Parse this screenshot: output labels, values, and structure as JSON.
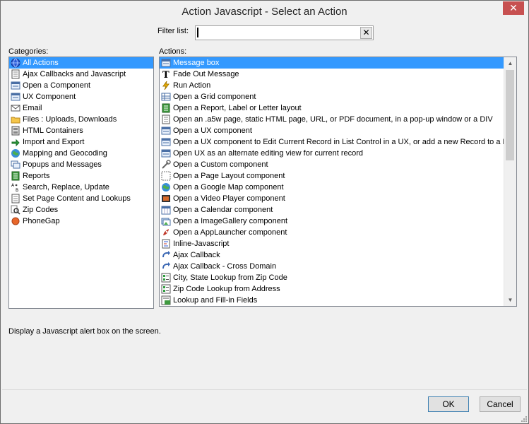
{
  "window": {
    "title": "Action Javascript - Select an Action",
    "close_glyph": "✕"
  },
  "filter": {
    "label": "Filter list:",
    "value": "",
    "clear_glyph": "✕"
  },
  "categories": {
    "label": "Categories:",
    "items": [
      {
        "label": "All Actions",
        "icon": "globe-icon",
        "selected": true
      },
      {
        "label": "Ajax Callbacks and Javascript",
        "icon": "document-icon"
      },
      {
        "label": "Open a Component",
        "icon": "window-icon"
      },
      {
        "label": "UX Component",
        "icon": "form-icon"
      },
      {
        "label": "Email",
        "icon": "email-icon"
      },
      {
        "label": "Files : Uploads, Downloads",
        "icon": "folder-icon"
      },
      {
        "label": "HTML Containers",
        "icon": "container-icon"
      },
      {
        "label": "Import and Export",
        "icon": "import-icon"
      },
      {
        "label": "Mapping and Geocoding",
        "icon": "map-icon"
      },
      {
        "label": "Popups and Messages",
        "icon": "popup-icon"
      },
      {
        "label": "Reports",
        "icon": "report-icon"
      },
      {
        "label": "Search, Replace, Update",
        "icon": "search-replace-icon"
      },
      {
        "label": "Set Page Content and Lookups",
        "icon": "page-icon"
      },
      {
        "label": "Zip Codes",
        "icon": "zip-search-icon"
      },
      {
        "label": "PhoneGap",
        "icon": "phonegap-icon"
      }
    ]
  },
  "actions": {
    "label": "Actions:",
    "items": [
      {
        "label": "Message box",
        "icon": "message-box-icon",
        "selected": true
      },
      {
        "label": "Fade Out Message",
        "icon": "text-icon"
      },
      {
        "label": "Run Action",
        "icon": "lightning-icon"
      },
      {
        "label": "Open a Grid component",
        "icon": "grid-icon"
      },
      {
        "label": "Open a Report, Label or Letter layout",
        "icon": "report-icon"
      },
      {
        "label": "Open an .a5w page, static HTML page, URL, or PDF document, in a pop-up window or a DIV",
        "icon": "page-icon"
      },
      {
        "label": "Open a UX component",
        "icon": "form-icon"
      },
      {
        "label": "Open a UX component to Edit Current Record in List Control in a UX, or add a new Record to a List",
        "icon": "form-icon"
      },
      {
        "label": "Open UX as an alternate editing view for current record",
        "icon": "form-icon"
      },
      {
        "label": "Open a Custom component",
        "icon": "tools-icon"
      },
      {
        "label": "Open a Page Layout component",
        "icon": "layout-icon"
      },
      {
        "label": "Open a Google Map component",
        "icon": "map-icon"
      },
      {
        "label": "Open a Video Player component",
        "icon": "video-icon"
      },
      {
        "label": "Open a Calendar component",
        "icon": "calendar-icon"
      },
      {
        "label": "Open a ImageGallery component",
        "icon": "gallery-icon"
      },
      {
        "label": "Open a AppLauncher component",
        "icon": "rocket-icon"
      },
      {
        "label": "Inline-Javascript",
        "icon": "script-icon"
      },
      {
        "label": "Ajax Callback",
        "icon": "callback-icon"
      },
      {
        "label": "Ajax Callback - Cross Domain",
        "icon": "callback-icon"
      },
      {
        "label": "City, State Lookup from Zip Code",
        "icon": "lookup-icon"
      },
      {
        "label": "Zip Code Lookup from Address",
        "icon": "lookup-icon"
      },
      {
        "label": "Lookup and Fill-in Fields",
        "icon": "fill-icon"
      }
    ]
  },
  "description": "Display a Javascript alert box on the screen.",
  "buttons": {
    "ok": "OK",
    "cancel": "Cancel"
  },
  "scrollbar": {
    "up_glyph": "▲",
    "down_glyph": "▼"
  }
}
